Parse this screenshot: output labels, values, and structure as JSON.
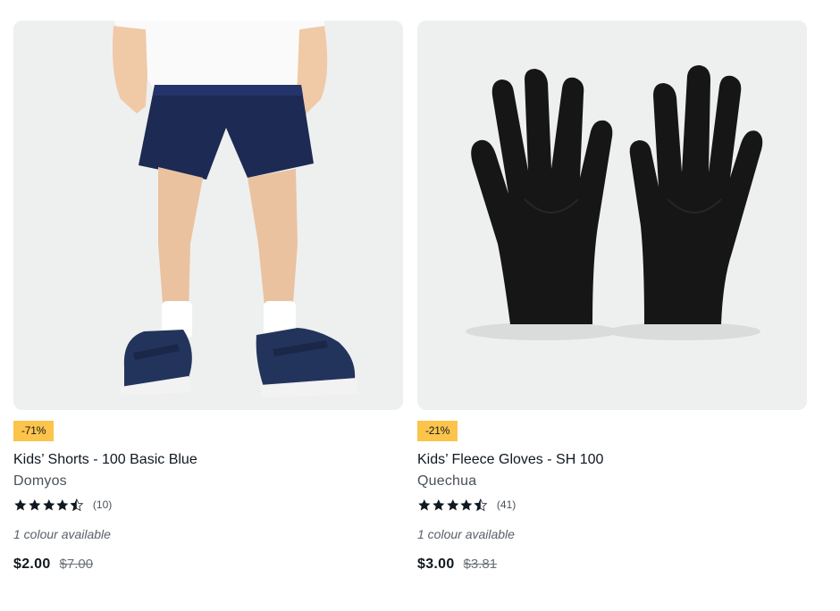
{
  "products": [
    {
      "image_alt": "Kids' shorts worn by child",
      "discount_badge": "-71%",
      "title": "Kids’ Shorts - 100 Basic Blue",
      "brand": "Domyos",
      "rating": 4.5,
      "rating_count": "(10)",
      "colours": "1 colour available",
      "price": "$2.00",
      "original_price": "$7.00"
    },
    {
      "image_alt": "Black fleece gloves",
      "discount_badge": "-21%",
      "title": "Kids’ Fleece Gloves - SH 100",
      "brand": "Quechua",
      "rating": 4.5,
      "rating_count": "(41)",
      "colours": "1 colour available",
      "price": "$3.00",
      "original_price": "$3.81"
    }
  ],
  "colors": {
    "badge": "#fcc44b",
    "text": "#101820",
    "muted": "#4a5159",
    "image_bg": "#eef0ef"
  }
}
